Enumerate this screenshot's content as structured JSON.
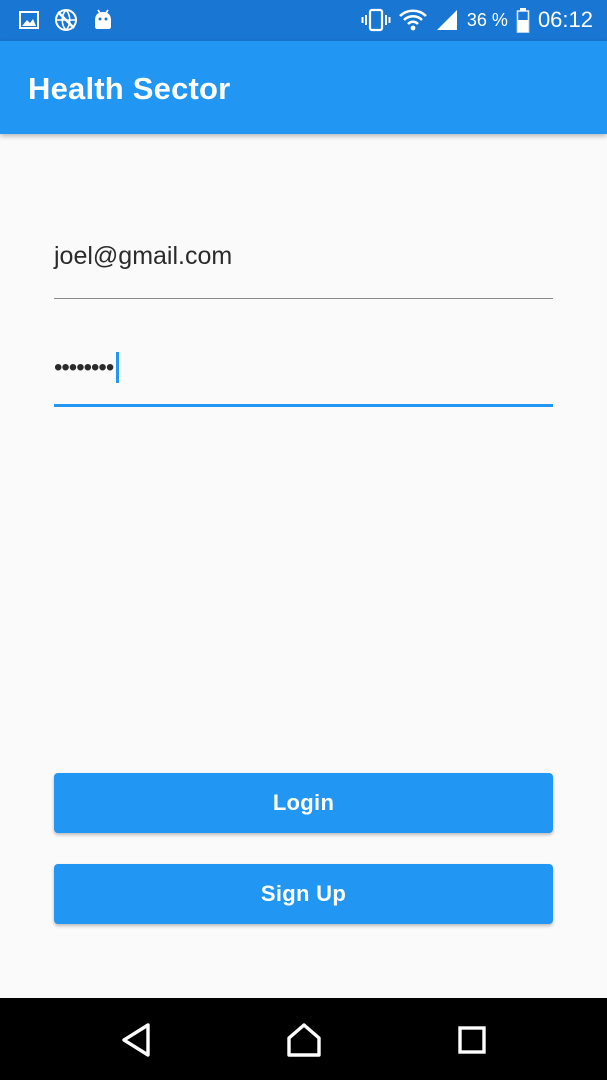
{
  "status_bar": {
    "icons_left": [
      "image-icon",
      "globe-icon",
      "android-icon"
    ],
    "icons_right": [
      "vibrate-icon",
      "wifi-icon",
      "signal-icon"
    ],
    "battery_percent": "36 %",
    "time": "06:12",
    "color": "#1976d2"
  },
  "app_bar": {
    "title": "Health Sector",
    "color": "#2196f3"
  },
  "form": {
    "email_value": "joel@gmail.com",
    "password_masked": "••••••••",
    "accent_color": "#2196f3"
  },
  "buttons": {
    "login_label": "Login",
    "signup_label": "Sign Up"
  },
  "nav_bar": {
    "icons": [
      "back-icon",
      "home-icon",
      "recents-icon"
    ]
  }
}
